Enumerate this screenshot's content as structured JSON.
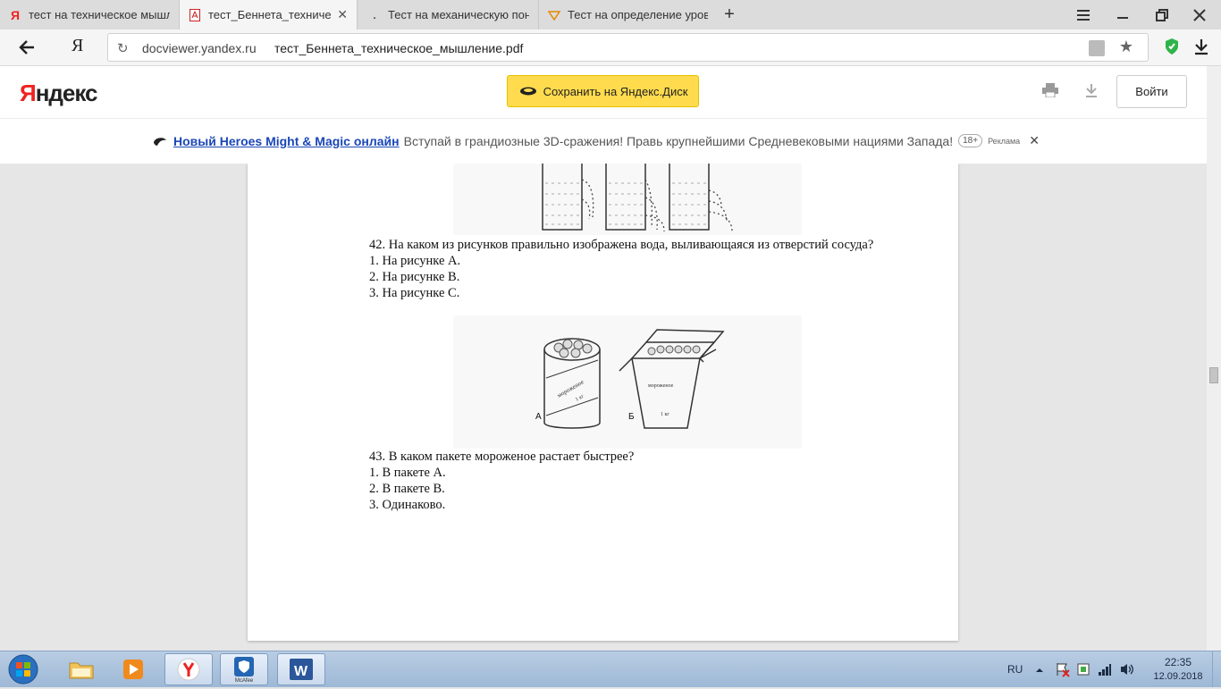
{
  "tabs": [
    {
      "title": "тест на техническое мышле",
      "icon": "yandex-icon"
    },
    {
      "title": "тест_Беннета_техническо",
      "icon": "pdf-icon",
      "active": true,
      "close": "✕"
    },
    {
      "title": "Тест на механическую пони",
      "icon": "dot-icon"
    },
    {
      "title": "Тест на определение уровн",
      "icon": "arrow-icon"
    }
  ],
  "new_tab": "+",
  "address": {
    "back_icon": "back-arrow-icon",
    "ya_button": "Я",
    "reload": "↻",
    "domain": "docviewer.yandex.ru",
    "path": "тест_Беннета_техническое_мышление.pdf",
    "star": "★"
  },
  "header": {
    "logo_first": "Я",
    "logo_rest": "ндекс",
    "save_button": "Сохранить на Яндекс.Диск",
    "login_button": "Войти"
  },
  "ad": {
    "link": "Новый Heroes Might & Magic онлайн",
    "text": "Вступай в грандиозные 3D-сражения! Правь крупнейшими Средневековыми нациями Запада!",
    "age": "18+",
    "label": "Реклама",
    "close": "✕"
  },
  "document": {
    "q42": {
      "text": "42. На каком из рисунков правильно изображена вода, выливающаяся из отверстий сосуда?",
      "options": [
        "1. На рисунке А.",
        "2. На рисунке В.",
        "3. На рисунке С."
      ]
    },
    "fig2": {
      "label_a": "А",
      "label_b": "Б",
      "can_text": "мороженое",
      "can_weight": "1 кг",
      "box_text": "мороженое",
      "box_weight": "1 кг"
    },
    "q43": {
      "text": "43. В каком пакете мороженое растает быстрее?",
      "options": [
        "1. В пакете А.",
        "2. В пакете В.",
        "3. Одинаково."
      ]
    }
  },
  "taskbar": {
    "lang": "RU",
    "time": "22:35",
    "date": "12.09.2018",
    "mcafee_label": "McAfee"
  },
  "colors": {
    "accent_yellow": "#ffdb4d",
    "ad_link": "#1a47b8",
    "logo_red": "#ee2222"
  }
}
